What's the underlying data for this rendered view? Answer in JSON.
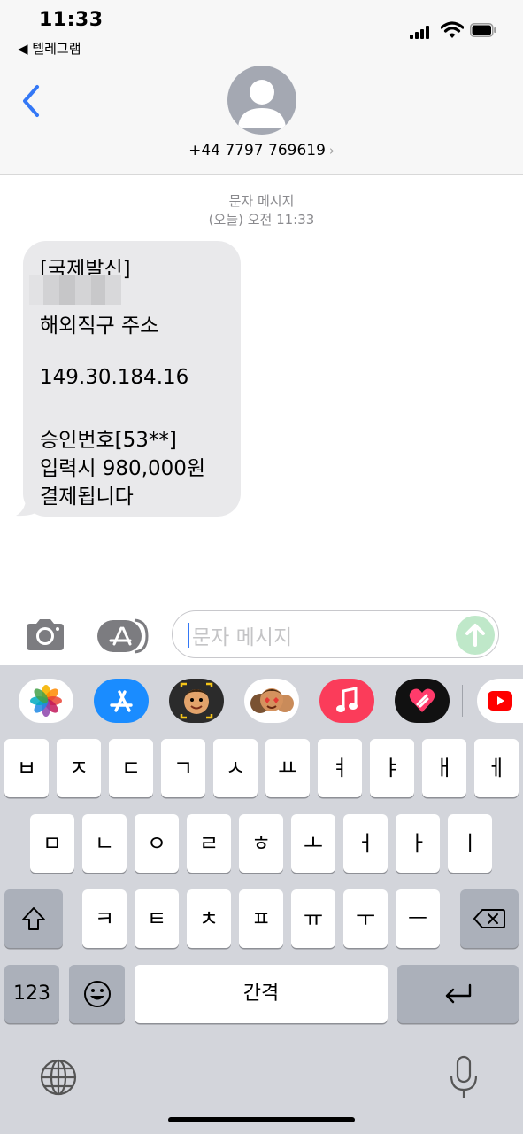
{
  "status_bar": {
    "time": "11:33",
    "back_app": "◀ 텔레그램"
  },
  "header": {
    "phone_number": "+44 7797 769619",
    "chevron": "›"
  },
  "thread": {
    "service_label": "문자 메시지",
    "timestamp": "(오늘) 오전 11:33",
    "message_lines": [
      "[국제발신]",
      "해외직구 주소",
      "149.30.184.16",
      "승인번호[53**]",
      "입력시 980,000원",
      "결제됩니다"
    ]
  },
  "compose": {
    "placeholder": "문자 메시지"
  },
  "app_strip": [
    "photos-app",
    "app-store-app",
    "memoji-app",
    "animoji-stickers-app",
    "music-app",
    "digital-touch-app",
    "youtube-app"
  ],
  "keyboard": {
    "row1": [
      "ㅂ",
      "ㅈ",
      "ㄷ",
      "ㄱ",
      "ㅅ",
      "ㅛ",
      "ㅕ",
      "ㅑ",
      "ㅐ",
      "ㅔ"
    ],
    "row2": [
      "ㅁ",
      "ㄴ",
      "ㅇ",
      "ㄹ",
      "ㅎ",
      "ㅗ",
      "ㅓ",
      "ㅏ",
      "ㅣ"
    ],
    "row3": [
      "ㅋ",
      "ㅌ",
      "ㅊ",
      "ㅍ",
      "ㅠ",
      "ㅜ",
      "ㅡ"
    ],
    "numbers_key": "123",
    "space_key": "간격"
  },
  "colors": {
    "accent": "#3478f6",
    "bubble": "#e9e9eb",
    "keyboard_bg": "#d3d5db",
    "send_disabled": "#bfe8c9"
  }
}
